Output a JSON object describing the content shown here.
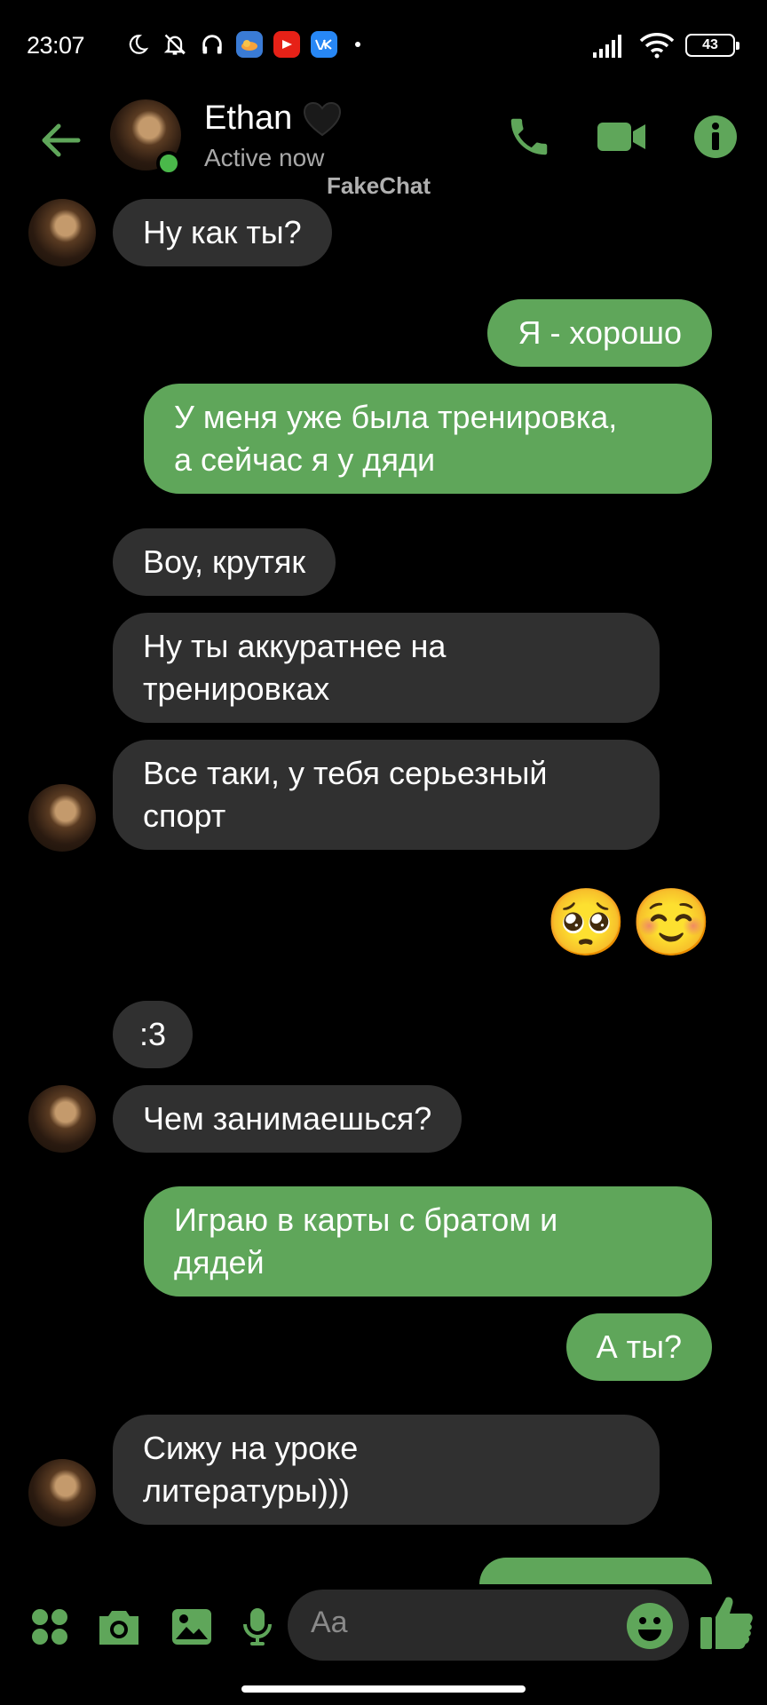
{
  "status_bar": {
    "time": "23:07",
    "battery": "43",
    "icons": [
      "moon-icon",
      "muted-bell-icon",
      "headphones-icon",
      "cloud-app-icon",
      "youtube-icon",
      "vk-icon",
      "signal-icon",
      "wifi-icon",
      "battery-icon"
    ]
  },
  "header": {
    "name": "Ethan",
    "status": "Active now",
    "watermark": "FakeChat"
  },
  "messages": [
    {
      "id": 1,
      "side": "in",
      "lines": [
        "Ну как ты?"
      ]
    },
    {
      "id": 2,
      "side": "out",
      "lines": [
        "Я - хорошо"
      ]
    },
    {
      "id": 3,
      "side": "out",
      "lines": [
        "У меня уже была тренировка,",
        "а сейчас я у дяди"
      ]
    },
    {
      "id": 4,
      "side": "in",
      "lines": [
        "Воу, крутяк"
      ]
    },
    {
      "id": 5,
      "side": "in",
      "lines": [
        "Ну ты аккуратнее на",
        "тренировках"
      ]
    },
    {
      "id": 6,
      "side": "in",
      "lines": [
        "Все таки, у тебя серьезный",
        "спорт"
      ]
    },
    {
      "id": 7,
      "side": "out",
      "emoji": [
        "🥺",
        "☺️"
      ]
    },
    {
      "id": 8,
      "side": "in",
      "lines": [
        ":3"
      ]
    },
    {
      "id": 9,
      "side": "in",
      "lines": [
        "Чем занимаешься?"
      ]
    },
    {
      "id": 10,
      "side": "out",
      "lines": [
        "Играю в карты с братом и",
        "дядей"
      ]
    },
    {
      "id": 11,
      "side": "out",
      "lines": [
        "А ты?"
      ]
    },
    {
      "id": 12,
      "side": "in",
      "lines": [
        "Сижу на уроке",
        "литературы)))"
      ]
    }
  ],
  "composer": {
    "placeholder": "Aa"
  },
  "colors": {
    "accent": "#5fa65a",
    "incoming_bubble": "#303030",
    "background": "#000000"
  }
}
